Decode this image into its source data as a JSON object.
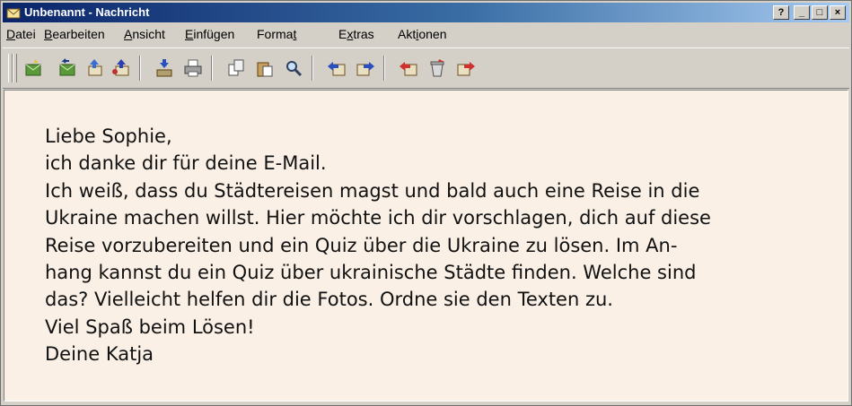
{
  "window": {
    "title": "Unbenannt - Nachricht",
    "titlebar_colors": [
      "#0a246a",
      "#a6caf0"
    ],
    "buttons": {
      "help": "?",
      "minimize": "_",
      "maximize": "□",
      "close": "×"
    }
  },
  "menubar": {
    "items": [
      {
        "mnemonic": "D",
        "rest": "atei"
      },
      {
        "mnemonic": "B",
        "rest": "earbeiten"
      },
      {
        "mnemonic": "A",
        "rest": "nsicht"
      },
      {
        "mnemonic": "E",
        "rest": "infügen"
      },
      {
        "pre": "Forma",
        "mnemonic": "t",
        "rest": ""
      },
      {
        "pre": "E",
        "mnemonic": "x",
        "rest": "tras"
      },
      {
        "pre": "Akt",
        "mnemonic": "i",
        "rest": "onen"
      }
    ]
  },
  "toolbar": {
    "icons": [
      "new-message-icon",
      "reply-icon",
      "reply-all-icon",
      "forward-icon",
      "save-icon",
      "print-icon",
      "copy-icon",
      "paste-icon",
      "find-icon",
      "send-icon",
      "receive-icon",
      "address-book-icon",
      "delete-icon",
      "move-icon"
    ]
  },
  "message": {
    "background": "#faf0e6",
    "lines": [
      "Liebe Sophie,",
      "ich danke dir für deine E-Mail.",
      "Ich weiß, dass du Städtereisen magst und bald auch eine Reise in die",
      "Ukraine machen willst. Hier möchte ich dir vorschlagen, dich auf diese",
      "Reise vorzubereiten und ein Quiz über die Ukraine zu lösen. Im An-",
      "hang kannst du ein Quiz über ukrainische Städte finden. Welche sind",
      "das? Vielleicht helfen dir die Fotos. Ordne sie den Texten zu.",
      "Viel Spaß beim Lösen!",
      "Deine Katja"
    ]
  }
}
